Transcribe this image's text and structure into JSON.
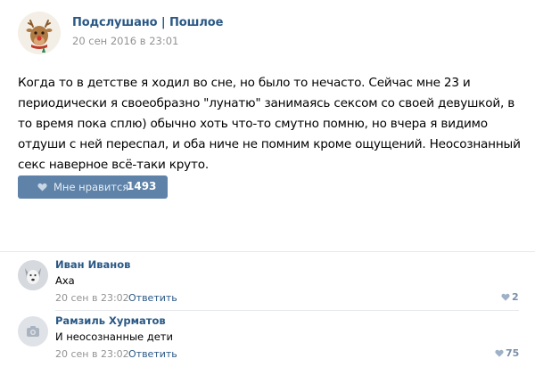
{
  "post": {
    "author": "Подслушано | Пошлое",
    "date": "20 сен 2016 в 23:01",
    "text": "Когда то в детстве я ходил во сне, но было то нечасто. Сейчас мне 23 и периодически я своеобразно \"лунатю\" занимаясь сексом со своей девушкой, в то время пока сплю) обычно хоть что-то смутно помню, но вчера я видимо отдуши с ней переспал, и оба ниче не помним кроме ощущений. Неосознанный секс наверное всё-таки круто.",
    "like_label": "Мне нравится",
    "like_count": "1493",
    "like_color": "#5e82a8"
  },
  "comments": [
    {
      "author": "Иван Иванов",
      "text": "Аха",
      "date": "20 сен в 23:02",
      "reply": "Ответить",
      "likes": "2"
    },
    {
      "author": "Рамзиль Хурматов",
      "text": "И неосознанные дети",
      "date": "20 сен в 23:02",
      "reply": "Ответить",
      "likes": "75"
    }
  ],
  "icons": {
    "author_avatar": "reindeer-avatar-icon",
    "comment1_avatar": "dog-avatar-icon",
    "comment2_avatar": "camera-placeholder-icon",
    "like": "heart-icon"
  }
}
